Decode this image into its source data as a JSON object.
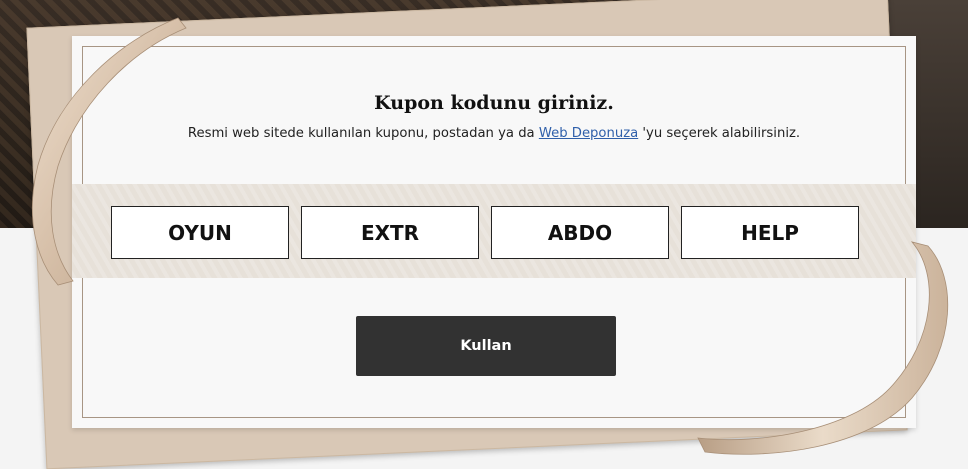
{
  "coupon": {
    "title": "Kupon kodunu giriniz.",
    "subtitle_before": "Resmi web sitede kullanılan kuponu, postadan ya da ",
    "subtitle_link": "Web Deponuza",
    "subtitle_after": " 'yu seçerek alabilirsiniz.",
    "code_parts": [
      "OYUN",
      "EXTR",
      "ABDO",
      "HELP"
    ],
    "submit_label": "Kullan"
  },
  "colors": {
    "button_bg": "#323232",
    "link": "#2f5faa",
    "band": "#e7e1d9"
  }
}
